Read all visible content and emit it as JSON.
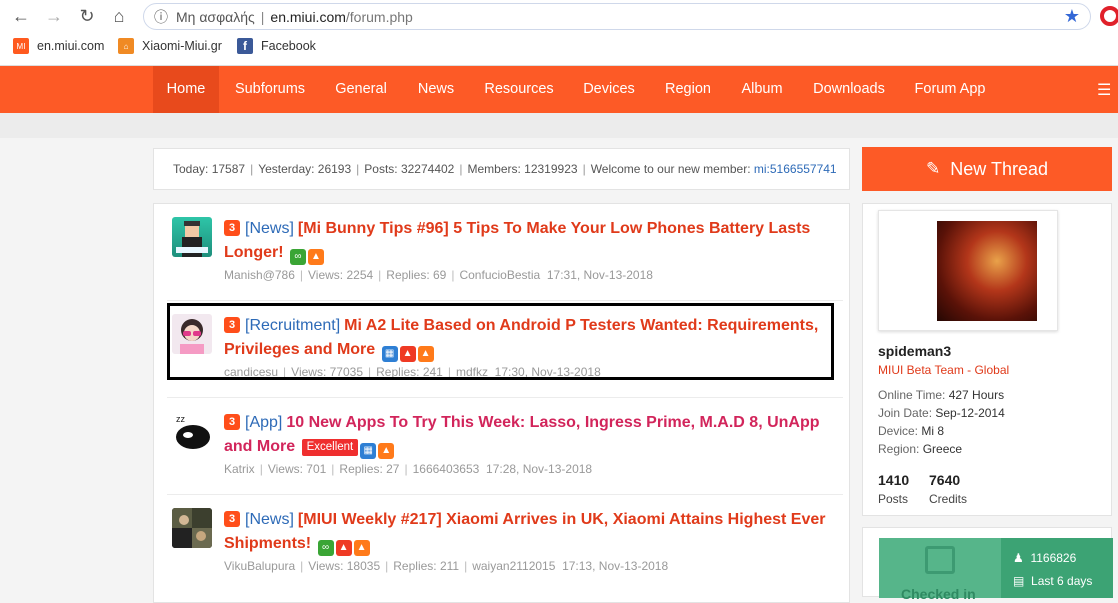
{
  "browser": {
    "security_label": "Μη ασφαλής",
    "url_domain": "en.miui.com",
    "url_path": "/forum.php",
    "bookmarks": [
      {
        "label": "en.miui.com",
        "icon": "miui-icon"
      },
      {
        "label": "Xiaomi-Miui.gr",
        "icon": "home-icon"
      },
      {
        "label": "Facebook",
        "icon": "facebook-icon"
      }
    ]
  },
  "nav": {
    "items": [
      "Home",
      "Subforums",
      "General",
      "News",
      "Resources",
      "Devices",
      "Region",
      "Album",
      "Downloads",
      "Forum App"
    ],
    "active": "Home"
  },
  "stats": {
    "today": "Today: 17587",
    "yesterday": "Yesterday: 26193",
    "posts": "Posts: 32274402",
    "members": "Members: 12319923",
    "welcome": "Welcome to our new member:",
    "new_member": "mi:5166557741"
  },
  "new_thread_label": "New Thread",
  "threads": [
    {
      "num": "3",
      "category": "[News]",
      "title": "[Mi Bunny Tips #96] 5 Tips To Make Your Low Phones Battery Lasts Longer!",
      "author": "Manish@786",
      "views": "Views:  2254",
      "replies": "Replies:  69",
      "last": "ConfucioBestia",
      "time": "17:31, Nov-13-2018"
    },
    {
      "num": "3",
      "category": "[Recruitment]",
      "title": "Mi A2 Lite Based on Android P Testers Wanted: Requirements, Privileges and More",
      "author": "candicesu",
      "views": "Views:  77035",
      "replies": "Replies:  241",
      "last": "mdfkz",
      "time": "17:30, Nov-13-2018"
    },
    {
      "num": "3",
      "category": "[App]",
      "title": "10 New Apps To Try This Week: Lasso, Ingress Prime, M.A.D 8, UnApp and More",
      "excellent": "Excellent",
      "author": "Katrix",
      "views": "Views:  701",
      "replies": "Replies:  27",
      "last": "1666403653",
      "time": "17:28, Nov-13-2018"
    },
    {
      "num": "3",
      "category": "[News]",
      "title": "[MIUI Weekly #217] Xiaomi Arrives in UK, Xiaomi Attains Highest Ever Shipments!",
      "author": "VikuBalupura",
      "views": "Views:  18035",
      "replies": "Replies:  211",
      "last": "waiyan2112015",
      "time": "17:13, Nov-13-2018"
    }
  ],
  "profile": {
    "name": "spideman3",
    "group": "MIUI Beta Team - Global",
    "online_label": "Online Time:",
    "online_value": "427 Hours",
    "join_label": "Join Date:",
    "join_value": "Sep-12-2014",
    "device_label": "Device:",
    "device_value": "Mi 8",
    "region_label": "Region:",
    "region_value": "Greece",
    "posts_value": "1410",
    "posts_label": "Posts",
    "credits_value": "7640",
    "credits_label": "Credits"
  },
  "checkin": {
    "label": "Checked in",
    "count": "1166826",
    "days": "Last 6 days"
  },
  "colors": {
    "brand": "#fd5a26",
    "title_red": "#e03a1a",
    "link_blue": "#2d6ab7"
  }
}
